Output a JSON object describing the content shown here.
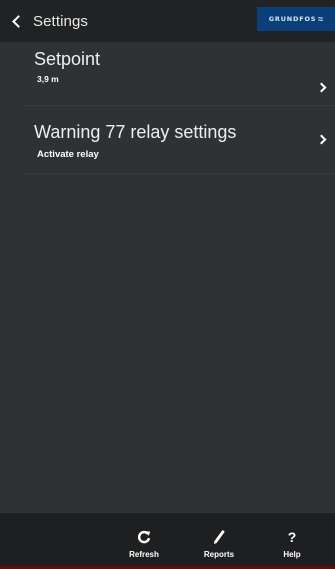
{
  "header": {
    "back_label": "Settings",
    "brand_text": "GRUNDFOS",
    "brand_mark": "≈",
    "brand_color": "#0b3f7a"
  },
  "settings_items": [
    {
      "title": "Setpoint",
      "subtitle": "3,9 m",
      "icon": "chevron-right-icon"
    },
    {
      "title": "Warning 77 relay settings",
      "subtitle": "Activate relay",
      "icon": "chevron-right-icon"
    }
  ],
  "bottom_bar": {
    "tabs": [
      {
        "label": "Refresh",
        "icon": "refresh-icon"
      },
      {
        "label": "Reports",
        "icon": "pencil-icon"
      },
      {
        "label": "Help",
        "icon": "help-icon",
        "glyph": "?"
      }
    ],
    "accent_edge_color": "#5a1010"
  }
}
